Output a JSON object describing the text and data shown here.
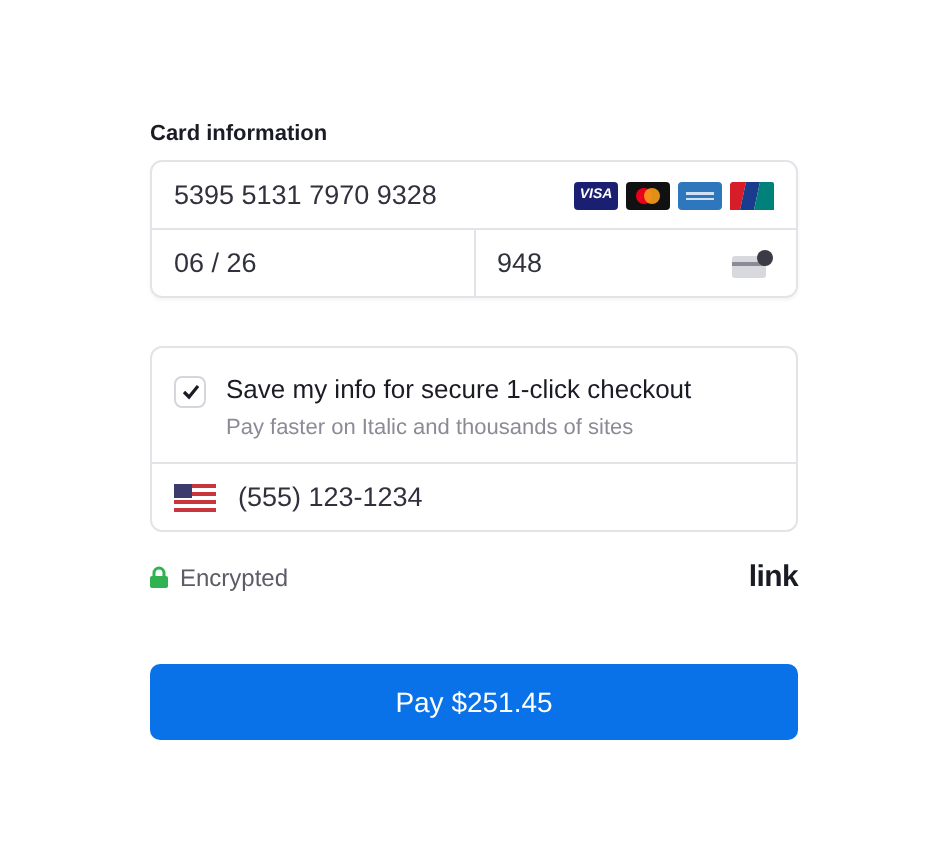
{
  "card_information": {
    "label": "Card information",
    "number": "5395 5131 7970 9328",
    "brands": [
      {
        "kind": "visa",
        "label": "VISA"
      },
      {
        "kind": "mastercard"
      },
      {
        "kind": "amex"
      },
      {
        "kind": "unionpay"
      }
    ],
    "expiry": "06 / 26",
    "cvc": "948"
  },
  "save_info": {
    "checked": true,
    "title": "Save my info for secure 1-click checkout",
    "subtitle": "Pay faster on Italic and thousands of sites",
    "phone": "(555) 123-1234"
  },
  "footer": {
    "security": "Encrypted",
    "logo": "link"
  },
  "pay_button": "Pay $251.45"
}
